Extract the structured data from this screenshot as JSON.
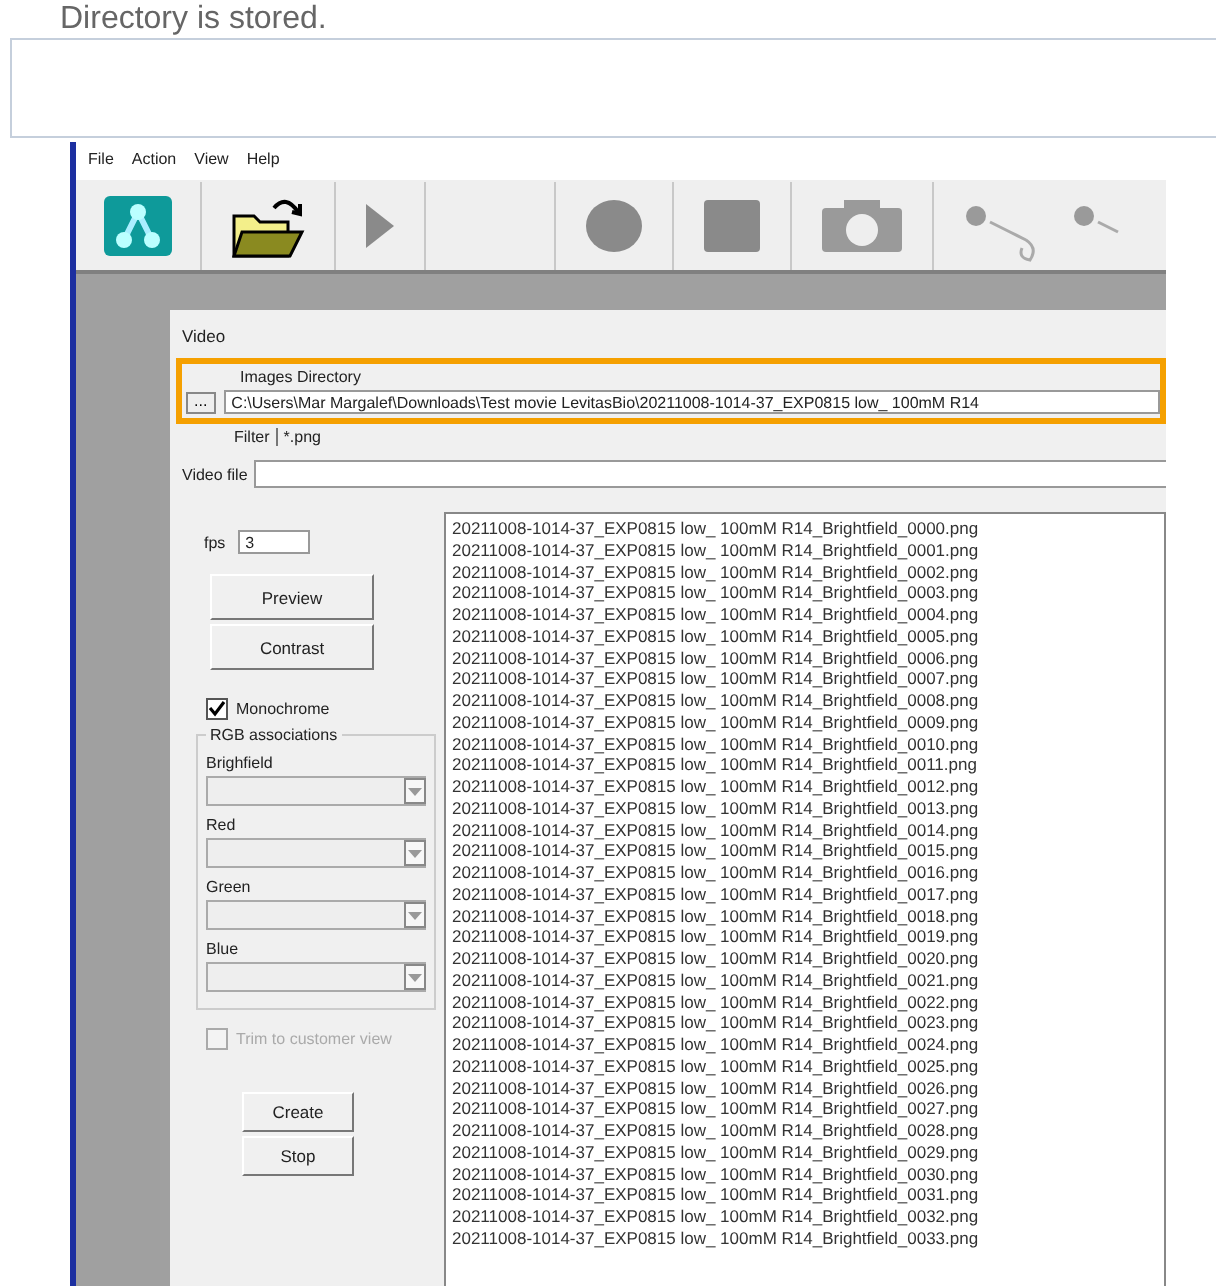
{
  "caption": "Directory is stored.",
  "menu": [
    "File",
    "Action",
    "View",
    "Help"
  ],
  "dialog": {
    "title": "Video",
    "images_directory": {
      "label": "Images Directory",
      "browse": "...",
      "value": "C:\\Users\\Mar Margalef\\Downloads\\Test movie LevitasBio\\20211008-1014-37_EXP0815 low_ 100mM R14"
    },
    "filter": {
      "label": "Filter",
      "value": "*.png"
    },
    "video_file": {
      "label": "Video file"
    },
    "fps": {
      "label": "fps",
      "value": "3"
    },
    "buttons": [
      "Preview",
      "Contrast"
    ],
    "monochrome": {
      "label": "Monochrome",
      "checked": true
    },
    "rgb": {
      "title": "RGB associations",
      "channels": [
        {
          "label": "Brighfield"
        },
        {
          "label": "Red"
        },
        {
          "label": "Green"
        },
        {
          "label": "Blue"
        }
      ]
    },
    "trim": {
      "label": "Trim to customer view",
      "checked": false,
      "disabled": true
    },
    "actions": [
      "Create",
      "Stop"
    ],
    "files": [
      "20211008-1014-37_EXP0815 low_ 100mM R14_Brightfield_0000.png",
      "20211008-1014-37_EXP0815 low_ 100mM R14_Brightfield_0001.png",
      "20211008-1014-37_EXP0815 low_ 100mM R14_Brightfield_0002.png",
      "20211008-1014-37_EXP0815 low_ 100mM R14_Brightfield_0003.png",
      "20211008-1014-37_EXP0815 low_ 100mM R14_Brightfield_0004.png",
      "20211008-1014-37_EXP0815 low_ 100mM R14_Brightfield_0005.png",
      "20211008-1014-37_EXP0815 low_ 100mM R14_Brightfield_0006.png",
      "20211008-1014-37_EXP0815 low_ 100mM R14_Brightfield_0007.png",
      "20211008-1014-37_EXP0815 low_ 100mM R14_Brightfield_0008.png",
      "20211008-1014-37_EXP0815 low_ 100mM R14_Brightfield_0009.png",
      "20211008-1014-37_EXP0815 low_ 100mM R14_Brightfield_0010.png",
      "20211008-1014-37_EXP0815 low_ 100mM R14_Brightfield_0011.png",
      "20211008-1014-37_EXP0815 low_ 100mM R14_Brightfield_0012.png",
      "20211008-1014-37_EXP0815 low_ 100mM R14_Brightfield_0013.png",
      "20211008-1014-37_EXP0815 low_ 100mM R14_Brightfield_0014.png",
      "20211008-1014-37_EXP0815 low_ 100mM R14_Brightfield_0015.png",
      "20211008-1014-37_EXP0815 low_ 100mM R14_Brightfield_0016.png",
      "20211008-1014-37_EXP0815 low_ 100mM R14_Brightfield_0017.png",
      "20211008-1014-37_EXP0815 low_ 100mM R14_Brightfield_0018.png",
      "20211008-1014-37_EXP0815 low_ 100mM R14_Brightfield_0019.png",
      "20211008-1014-37_EXP0815 low_ 100mM R14_Brightfield_0020.png",
      "20211008-1014-37_EXP0815 low_ 100mM R14_Brightfield_0021.png",
      "20211008-1014-37_EXP0815 low_ 100mM R14_Brightfield_0022.png",
      "20211008-1014-37_EXP0815 low_ 100mM R14_Brightfield_0023.png",
      "20211008-1014-37_EXP0815 low_ 100mM R14_Brightfield_0024.png",
      "20211008-1014-37_EXP0815 low_ 100mM R14_Brightfield_0025.png",
      "20211008-1014-37_EXP0815 low_ 100mM R14_Brightfield_0026.png",
      "20211008-1014-37_EXP0815 low_ 100mM R14_Brightfield_0027.png",
      "20211008-1014-37_EXP0815 low_ 100mM R14_Brightfield_0028.png",
      "20211008-1014-37_EXP0815 low_ 100mM R14_Brightfield_0029.png",
      "20211008-1014-37_EXP0815 low_ 100mM R14_Brightfield_0030.png",
      "20211008-1014-37_EXP0815 low_ 100mM R14_Brightfield_0031.png",
      "20211008-1014-37_EXP0815 low_ 100mM R14_Brightfield_0032.png",
      "20211008-1014-37_EXP0815 low_ 100mM R14_Brightfield_0033.png"
    ]
  }
}
